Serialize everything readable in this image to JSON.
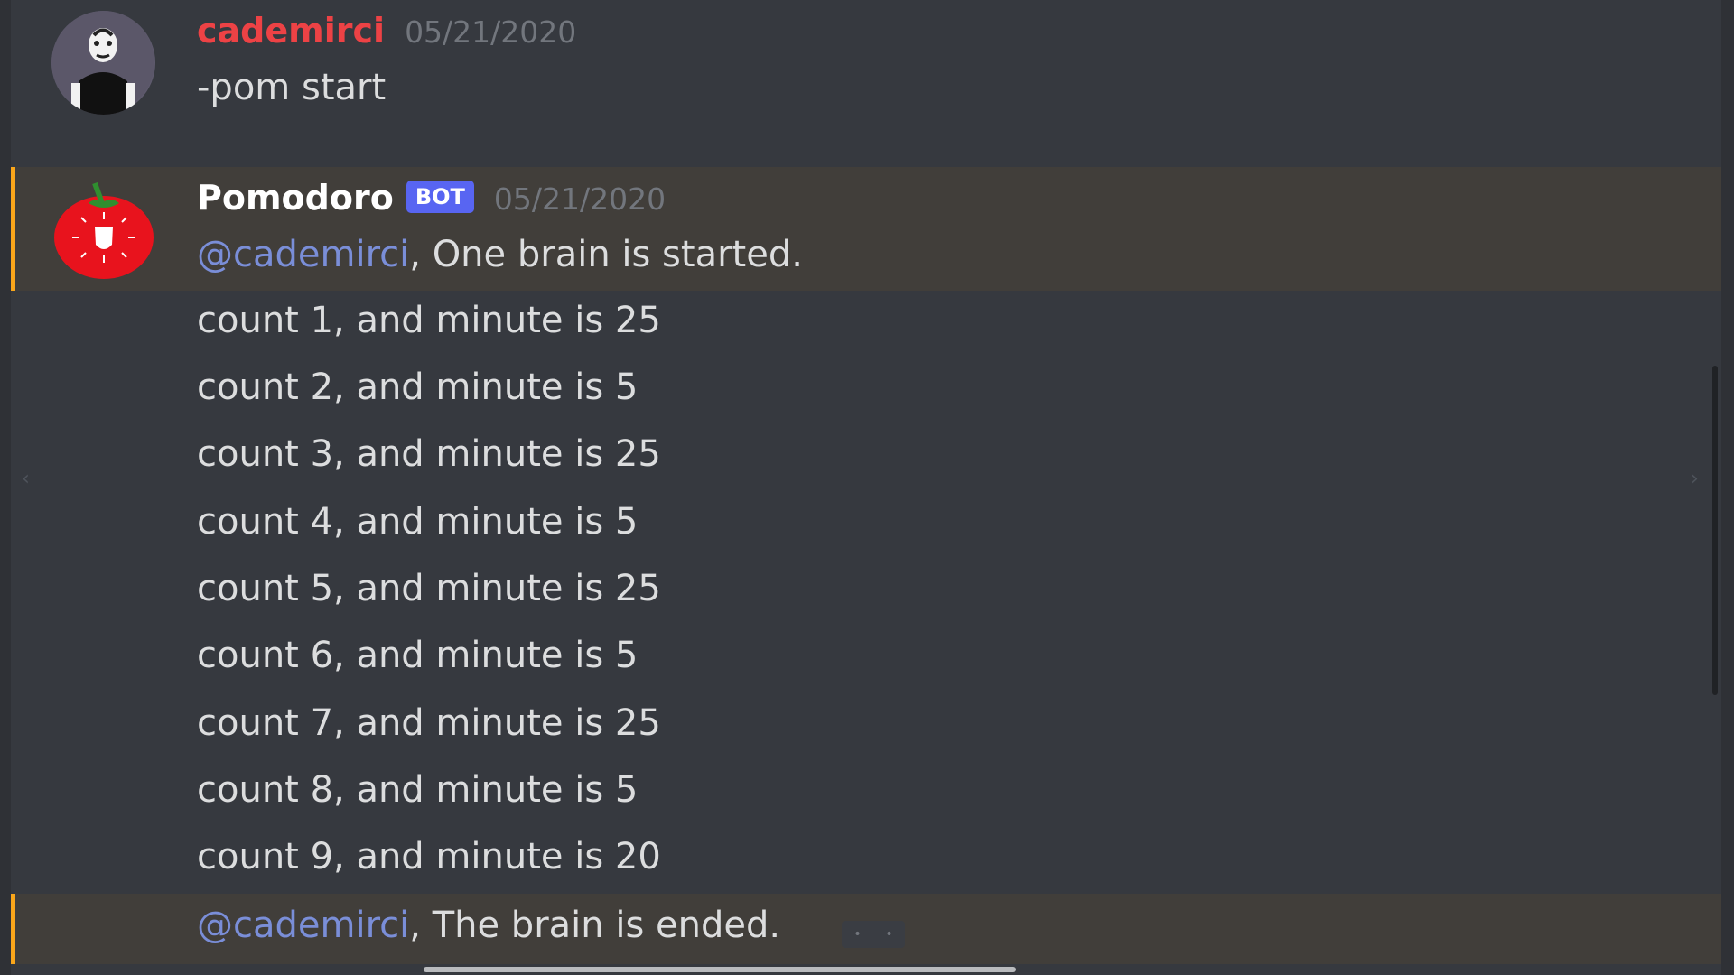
{
  "message1": {
    "username": "cademirci",
    "timestamp": "05/21/2020",
    "content": "-pom start"
  },
  "message2": {
    "username": "Pomodoro",
    "bot_tag": "BOT",
    "timestamp": "05/21/2020",
    "mention": "@cademirci",
    "content": ", One brain is started."
  },
  "counts": [
    "count 1, and minute is 25",
    "count 2, and minute is 5",
    "count 3, and minute is 25",
    "count 4, and minute is 5",
    "count 5, and minute is 25",
    "count 6, and minute is 5",
    "count 7, and minute is 25",
    "count 8, and minute is 5",
    "count 9, and minute is 20"
  ],
  "final": {
    "mention": "@cademirci",
    "content": ", The brain is ended."
  },
  "colors": {
    "background": "#36393f",
    "mention_highlight": "#413e3a",
    "mention_bar": "#faa61a",
    "user_name": "#ed4245",
    "mention_text": "#7a8ed8",
    "bot_tag": "#5865f2"
  },
  "icons": {
    "left_arrow": "‹",
    "right_arrow": "›"
  }
}
